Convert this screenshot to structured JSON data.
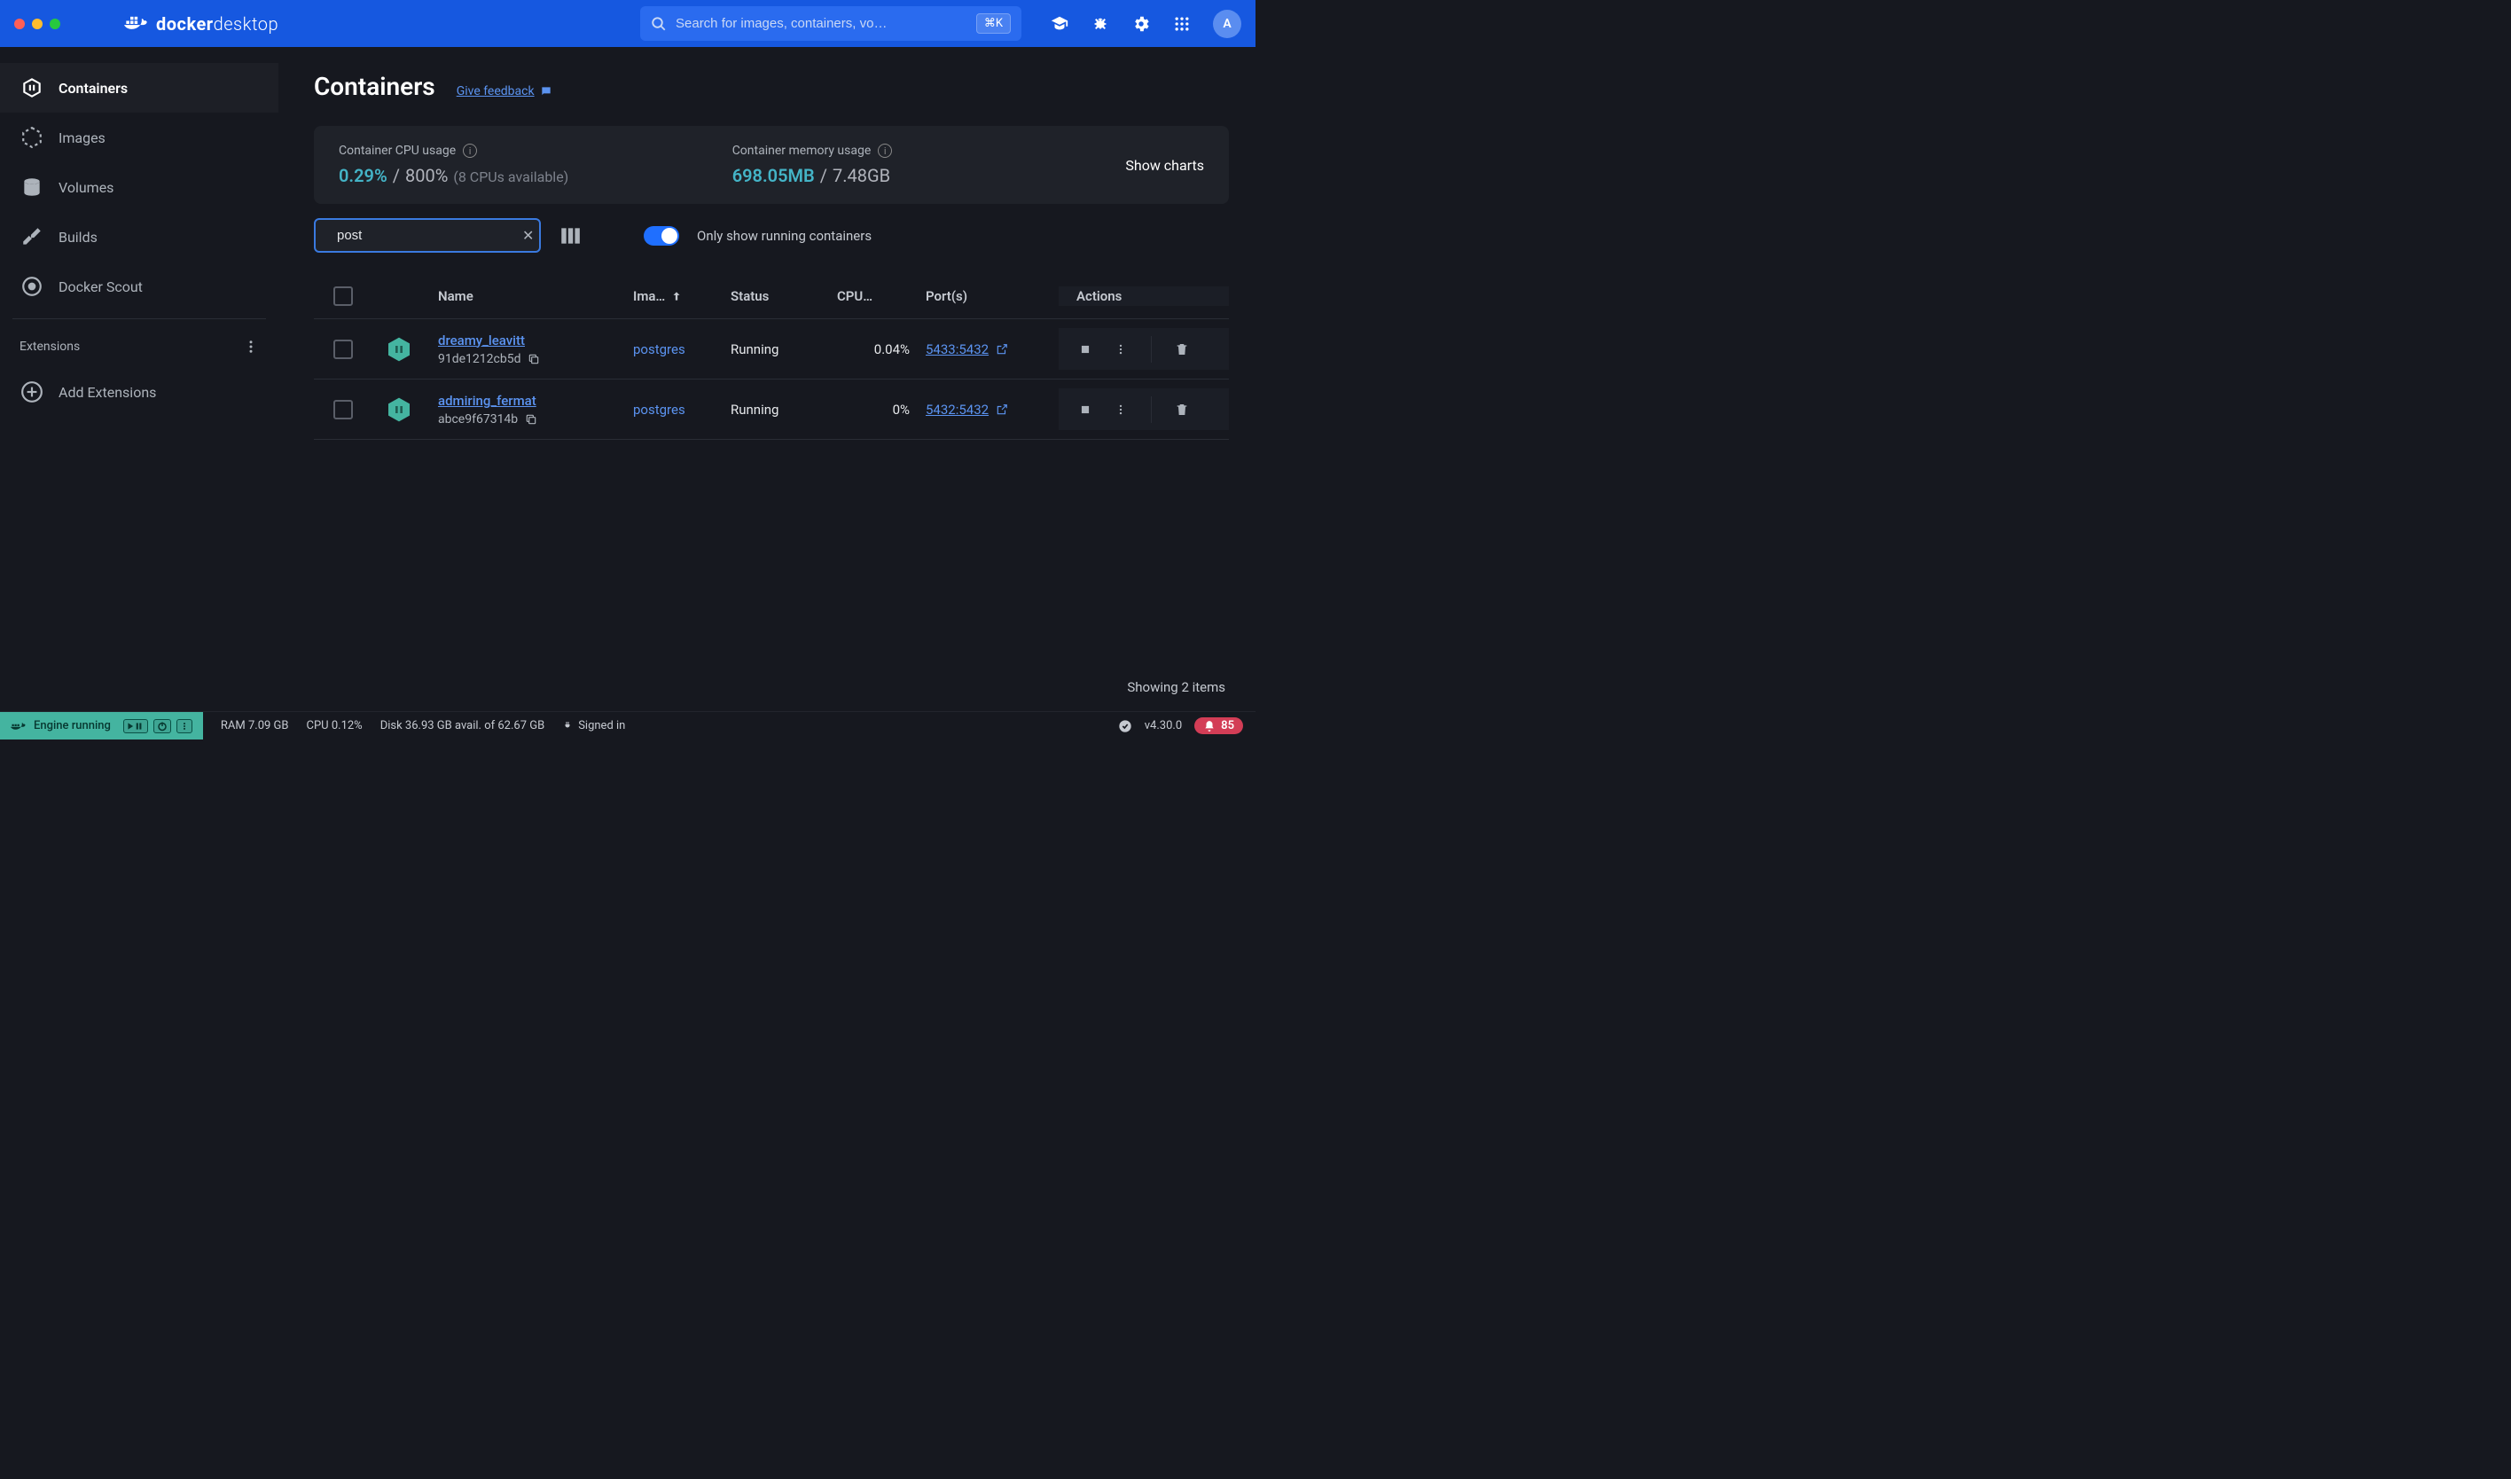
{
  "titlebar": {
    "logo_bold": "docker",
    "logo_light": "desktop",
    "search_placeholder": "Search for images, containers, vo…",
    "shortcut": "⌘K",
    "avatar_initial": "A"
  },
  "sidebar": {
    "items": [
      {
        "label": "Containers"
      },
      {
        "label": "Images"
      },
      {
        "label": "Volumes"
      },
      {
        "label": "Builds"
      },
      {
        "label": "Docker Scout"
      }
    ],
    "extensions_label": "Extensions",
    "add_extensions_label": "Add Extensions"
  },
  "page": {
    "title": "Containers",
    "feedback": "Give feedback"
  },
  "stats": {
    "cpu_label": "Container CPU usage",
    "cpu_usage": "0.29%",
    "cpu_slash": "/",
    "cpu_max": "800%",
    "cpu_note": "(8 CPUs available)",
    "mem_label": "Container memory usage",
    "mem_usage": "698.05MB",
    "mem_slash": "/",
    "mem_max": "7.48GB",
    "show_charts": "Show charts"
  },
  "controls": {
    "search_value": "post",
    "only_running_label": "Only show running containers"
  },
  "table": {
    "headers": {
      "name": "Name",
      "image": "Ima…",
      "status": "Status",
      "cpu": "CPU…",
      "ports": "Port(s)",
      "actions": "Actions"
    },
    "rows": [
      {
        "name": "dreamy_leavitt",
        "id": "91de1212cb5d",
        "image": "postgres",
        "status": "Running",
        "cpu": "0.04%",
        "port": "5433:5432"
      },
      {
        "name": "admiring_fermat",
        "id": "abce9f67314b",
        "image": "postgres",
        "status": "Running",
        "cpu": "0%",
        "port": "5432:5432"
      }
    ],
    "showing": "Showing 2 items"
  },
  "footer": {
    "engine": "Engine running",
    "ram": "RAM 7.09 GB",
    "cpu": "CPU 0.12%",
    "disk": "Disk 36.93 GB avail. of 62.67 GB",
    "signed": "Signed in",
    "version": "v4.30.0",
    "notif_count": "85"
  }
}
